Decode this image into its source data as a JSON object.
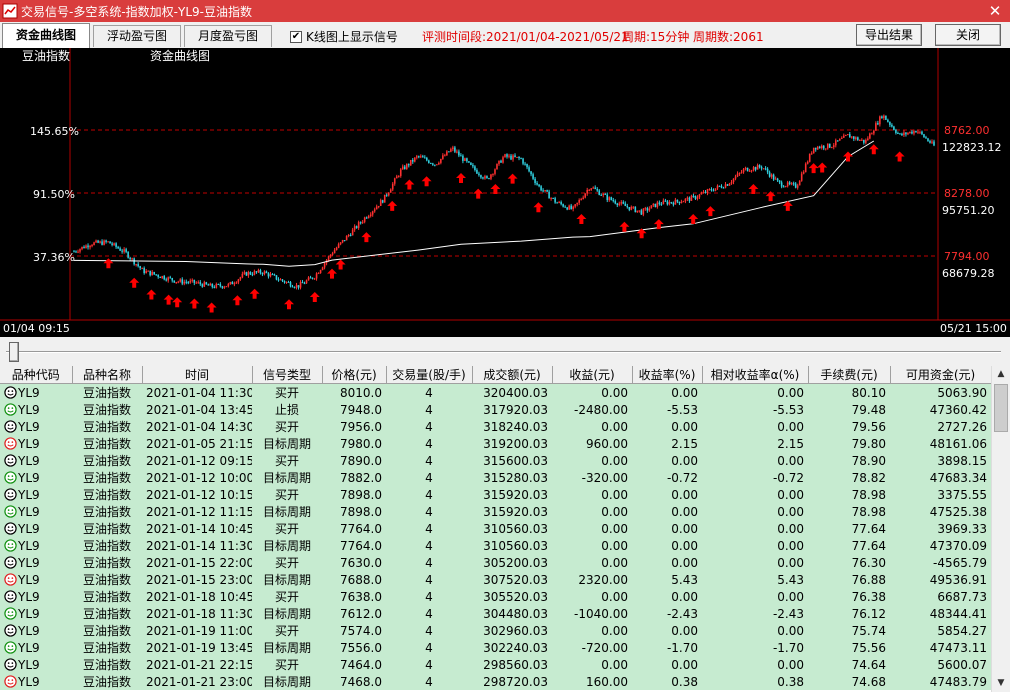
{
  "window": {
    "title": "交易信号-多空系统-指数加权-YL9-豆油指数",
    "close_glyph": "✕"
  },
  "tabs": [
    {
      "label": "资金曲线图",
      "active": true
    },
    {
      "label": "浮动盈亏图",
      "active": false
    },
    {
      "label": "月度盈亏图",
      "active": false
    }
  ],
  "options": {
    "show_signals_label": "K线图上显示信号",
    "show_signals_checked": true,
    "check_glyph": "✔"
  },
  "info": {
    "period_range": "评测时间段:2021/01/04-2021/05/21",
    "cycle": "周期:15分钟",
    "cycle_count": "周期数:2061"
  },
  "buttons": {
    "export": "导出结果",
    "close": "关闭"
  },
  "chart": {
    "instrument_label": "豆油指数",
    "curve_label": "资金曲线图",
    "left_axis": [
      "145.65%",
      "91.50%",
      "37.36%"
    ],
    "right_axis_prices": [
      "8762.00",
      "8278.00",
      "7794.00"
    ],
    "right_axis_capital": [
      "122823.12",
      "95751.20",
      "68679.28"
    ],
    "start_time": "01/04 09:15",
    "end_time": "05/21 15:00",
    "colors": {
      "background": "#000000",
      "up": "#ff3030",
      "down": "#30d0e0",
      "equity": "#ffffff",
      "signal": "#ff0000",
      "price_grid": "#c00000",
      "left_text": "#ffffff",
      "right_price_text": "#ff3030"
    }
  },
  "chart_data": {
    "type": "line",
    "name": "资金曲线图",
    "y_left_ticks": [
      "145.65%",
      "91.50%",
      "37.36%"
    ],
    "y_right_price_ticks": [
      8762.0,
      8278.0,
      7794.0
    ],
    "y_right_capital_ticks": [
      122823.12,
      95751.2,
      68679.28
    ],
    "x_range": [
      "01/04 09:15",
      "05/21 15:00"
    ],
    "series": [
      {
        "name": "豆油指数",
        "t": [
          0,
          0.02,
          0.04,
          0.06,
          0.08,
          0.1,
          0.12,
          0.14,
          0.16,
          0.18,
          0.2,
          0.22,
          0.24,
          0.26,
          0.28,
          0.3,
          0.32,
          0.34,
          0.36,
          0.38,
          0.4,
          0.42,
          0.44,
          0.46,
          0.48,
          0.5,
          0.52,
          0.54,
          0.56,
          0.58,
          0.6,
          0.62,
          0.64,
          0.66,
          0.68,
          0.7,
          0.72,
          0.74,
          0.76,
          0.78,
          0.8,
          0.82,
          0.84,
          0.86,
          0.88,
          0.9,
          0.92,
          0.94,
          0.96,
          0.98,
          1.0
        ],
        "price": [
          7830,
          7890,
          7900,
          7820,
          7680,
          7640,
          7600,
          7590,
          7560,
          7570,
          7660,
          7670,
          7610,
          7560,
          7640,
          7820,
          7960,
          8100,
          8230,
          8450,
          8560,
          8500,
          8620,
          8490,
          8380,
          8560,
          8540,
          8330,
          8210,
          8150,
          8330,
          8240,
          8180,
          8130,
          8200,
          8210,
          8240,
          8300,
          8350,
          8460,
          8480,
          8350,
          8330,
          8630,
          8640,
          8720,
          8670,
          8880,
          8720,
          8760,
          8640
        ]
      },
      {
        "name": "资金曲线",
        "t": [
          0.0,
          0.13,
          0.2,
          0.22,
          0.25,
          0.28,
          0.3,
          0.4,
          0.45,
          0.52,
          0.58,
          0.6,
          0.68,
          0.72,
          0.8,
          0.86,
          0.9,
          0.93
        ],
        "capital": [
          66800,
          66300,
          65300,
          65100,
          64300,
          65000,
          66900,
          71200,
          73700,
          75100,
          76800,
          77000,
          80900,
          82500,
          89600,
          94600,
          111400,
          118100
        ]
      }
    ],
    "signals_t": [
      0.04,
      0.07,
      0.09,
      0.11,
      0.12,
      0.14,
      0.16,
      0.19,
      0.21,
      0.25,
      0.28,
      0.3,
      0.31,
      0.34,
      0.37,
      0.39,
      0.41,
      0.45,
      0.47,
      0.49,
      0.51,
      0.54,
      0.59,
      0.64,
      0.66,
      0.68,
      0.72,
      0.74,
      0.79,
      0.81,
      0.83,
      0.86,
      0.87,
      0.9,
      0.93,
      0.96
    ]
  },
  "table": {
    "columns": [
      "品种代码",
      "品种名称",
      "时间",
      "信号类型",
      "价格(元)",
      "交易量(股/手)",
      "成交额(元)",
      "收益(元)",
      "收益率(%)",
      "相对收益率α(%)",
      "手续费(元)",
      "可用资金(元)"
    ],
    "rows": [
      {
        "icon": "smile",
        "code": "YL9",
        "name": "豆油指数",
        "time": "2021-01-04 11:30",
        "type": "买开",
        "price": "8010.0",
        "qty": "4",
        "amount": "320400.03",
        "profit": "0.00",
        "rate": "0.00",
        "rel": "0.00",
        "fee": "80.10",
        "capital": "5063.90"
      },
      {
        "icon": "smile-green",
        "code": "YL9",
        "name": "豆油指数",
        "time": "2021-01-04 13:45",
        "type": "止损",
        "price": "7948.0",
        "qty": "4",
        "amount": "317920.03",
        "profit": "-2480.00",
        "rate": "-5.53",
        "rel": "-5.53",
        "fee": "79.48",
        "capital": "47360.42"
      },
      {
        "icon": "smile",
        "code": "YL9",
        "name": "豆油指数",
        "time": "2021-01-04 14:30",
        "type": "买开",
        "price": "7956.0",
        "qty": "4",
        "amount": "318240.03",
        "profit": "0.00",
        "rate": "0.00",
        "rel": "0.00",
        "fee": "79.56",
        "capital": "2727.26"
      },
      {
        "icon": "smile-red",
        "code": "YL9",
        "name": "豆油指数",
        "time": "2021-01-05 21:15",
        "type": "目标周期",
        "price": "7980.0",
        "qty": "4",
        "amount": "319200.03",
        "profit": "960.00",
        "rate": "2.15",
        "rel": "2.15",
        "fee": "79.80",
        "capital": "48161.06"
      },
      {
        "icon": "smile",
        "code": "YL9",
        "name": "豆油指数",
        "time": "2021-01-12 09:15",
        "type": "买开",
        "price": "7890.0",
        "qty": "4",
        "amount": "315600.03",
        "profit": "0.00",
        "rate": "0.00",
        "rel": "0.00",
        "fee": "78.90",
        "capital": "3898.15"
      },
      {
        "icon": "smile-green",
        "code": "YL9",
        "name": "豆油指数",
        "time": "2021-01-12 10:00",
        "type": "目标周期",
        "price": "7882.0",
        "qty": "4",
        "amount": "315280.03",
        "profit": "-320.00",
        "rate": "-0.72",
        "rel": "-0.72",
        "fee": "78.82",
        "capital": "47683.34"
      },
      {
        "icon": "smile",
        "code": "YL9",
        "name": "豆油指数",
        "time": "2021-01-12 10:15",
        "type": "买开",
        "price": "7898.0",
        "qty": "4",
        "amount": "315920.03",
        "profit": "0.00",
        "rate": "0.00",
        "rel": "0.00",
        "fee": "78.98",
        "capital": "3375.55"
      },
      {
        "icon": "smile-green",
        "code": "YL9",
        "name": "豆油指数",
        "time": "2021-01-12 11:15",
        "type": "目标周期",
        "price": "7898.0",
        "qty": "4",
        "amount": "315920.03",
        "profit": "0.00",
        "rate": "0.00",
        "rel": "0.00",
        "fee": "78.98",
        "capital": "47525.38"
      },
      {
        "icon": "smile",
        "code": "YL9",
        "name": "豆油指数",
        "time": "2021-01-14 10:45",
        "type": "买开",
        "price": "7764.0",
        "qty": "4",
        "amount": "310560.03",
        "profit": "0.00",
        "rate": "0.00",
        "rel": "0.00",
        "fee": "77.64",
        "capital": "3969.33"
      },
      {
        "icon": "smile-green",
        "code": "YL9",
        "name": "豆油指数",
        "time": "2021-01-14 11:30",
        "type": "目标周期",
        "price": "7764.0",
        "qty": "4",
        "amount": "310560.03",
        "profit": "0.00",
        "rate": "0.00",
        "rel": "0.00",
        "fee": "77.64",
        "capital": "47370.09"
      },
      {
        "icon": "smile",
        "code": "YL9",
        "name": "豆油指数",
        "time": "2021-01-15 22:00",
        "type": "买开",
        "price": "7630.0",
        "qty": "4",
        "amount": "305200.03",
        "profit": "0.00",
        "rate": "0.00",
        "rel": "0.00",
        "fee": "76.30",
        "capital": "-4565.79"
      },
      {
        "icon": "smile-red",
        "code": "YL9",
        "name": "豆油指数",
        "time": "2021-01-15 23:00",
        "type": "目标周期",
        "price": "7688.0",
        "qty": "4",
        "amount": "307520.03",
        "profit": "2320.00",
        "rate": "5.43",
        "rel": "5.43",
        "fee": "76.88",
        "capital": "49536.91"
      },
      {
        "icon": "smile",
        "code": "YL9",
        "name": "豆油指数",
        "time": "2021-01-18 10:45",
        "type": "买开",
        "price": "7638.0",
        "qty": "4",
        "amount": "305520.03",
        "profit": "0.00",
        "rate": "0.00",
        "rel": "0.00",
        "fee": "76.38",
        "capital": "6687.73"
      },
      {
        "icon": "smile-green",
        "code": "YL9",
        "name": "豆油指数",
        "time": "2021-01-18 11:30",
        "type": "目标周期",
        "price": "7612.0",
        "qty": "4",
        "amount": "304480.03",
        "profit": "-1040.00",
        "rate": "-2.43",
        "rel": "-2.43",
        "fee": "76.12",
        "capital": "48344.41"
      },
      {
        "icon": "smile",
        "code": "YL9",
        "name": "豆油指数",
        "time": "2021-01-19 11:00",
        "type": "买开",
        "price": "7574.0",
        "qty": "4",
        "amount": "302960.03",
        "profit": "0.00",
        "rate": "0.00",
        "rel": "0.00",
        "fee": "75.74",
        "capital": "5854.27"
      },
      {
        "icon": "smile-green",
        "code": "YL9",
        "name": "豆油指数",
        "time": "2021-01-19 13:45",
        "type": "目标周期",
        "price": "7556.0",
        "qty": "4",
        "amount": "302240.03",
        "profit": "-720.00",
        "rate": "-1.70",
        "rel": "-1.70",
        "fee": "75.56",
        "capital": "47473.11"
      },
      {
        "icon": "smile",
        "code": "YL9",
        "name": "豆油指数",
        "time": "2021-01-21 22:15",
        "type": "买开",
        "price": "7464.0",
        "qty": "4",
        "amount": "298560.03",
        "profit": "0.00",
        "rate": "0.00",
        "rel": "0.00",
        "fee": "74.64",
        "capital": "5600.07"
      },
      {
        "icon": "smile-red",
        "code": "YL9",
        "name": "豆油指数",
        "time": "2021-01-21 23:00",
        "type": "目标周期",
        "price": "7468.0",
        "qty": "4",
        "amount": "298720.03",
        "profit": "160.00",
        "rate": "0.38",
        "rel": "0.38",
        "fee": "74.68",
        "capital": "47483.79"
      }
    ]
  }
}
